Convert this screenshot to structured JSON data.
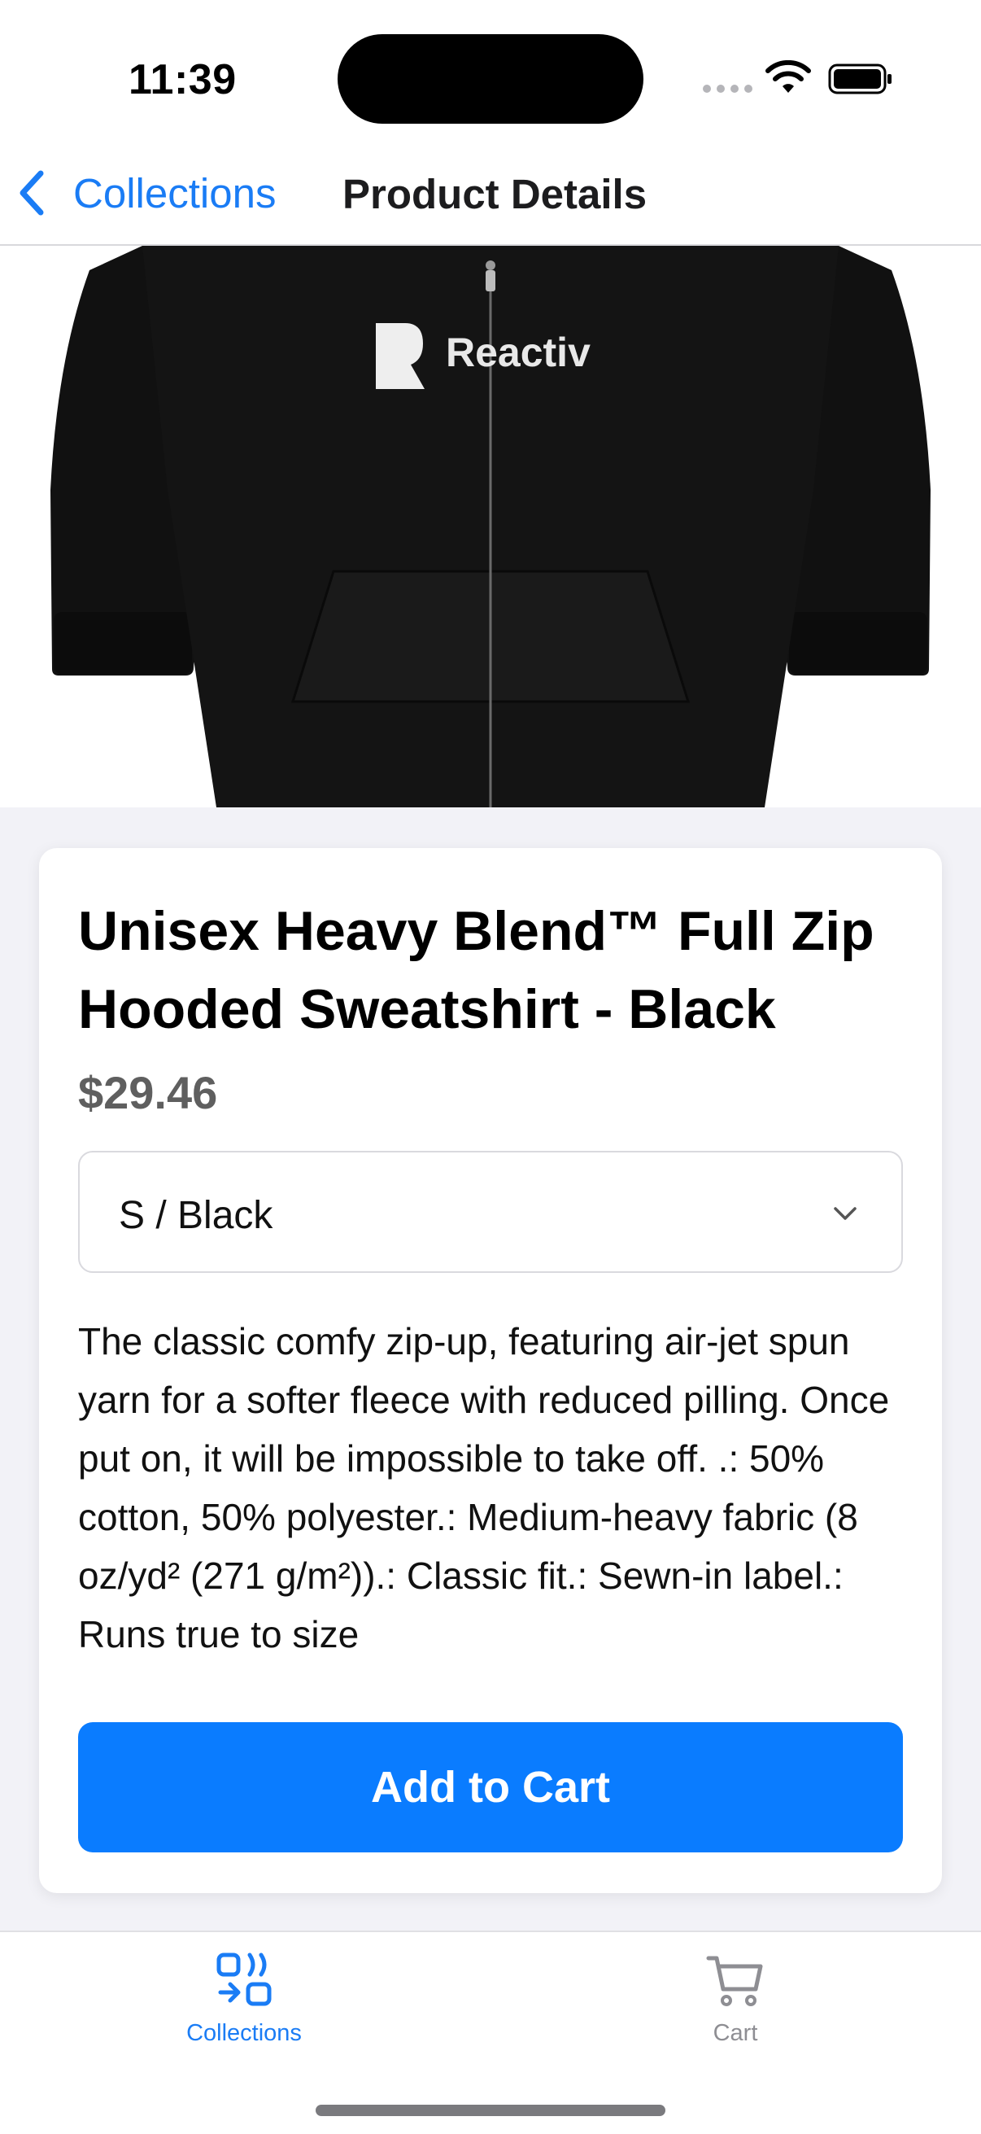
{
  "status_bar": {
    "time": "11:39"
  },
  "nav": {
    "back_label": "Collections",
    "title": "Product Details"
  },
  "product": {
    "image_brand_text": "Reactiv",
    "title": "Unisex Heavy Blend™ Full Zip Hooded Sweatshirt - Black",
    "price": "$29.46",
    "variant_selected": "S / Black",
    "description": "The classic comfy zip-up, featuring air-jet spun yarn for a softer fleece with reduced pilling. Once put on, it will be impossible to take off. .: 50% cotton, 50% polyester.: Medium-heavy fabric (8 oz/yd² (271 g/m²)).: Classic fit.: Sewn-in label.: Runs true to size",
    "add_to_cart_label": "Add to Cart"
  },
  "tab_bar": {
    "tabs": [
      {
        "label": "Collections",
        "icon": "collections-icon",
        "active": true
      },
      {
        "label": "Cart",
        "icon": "cart-icon",
        "active": false
      }
    ]
  },
  "colors": {
    "accent": "#1a7cf5",
    "button": "#0a7cff",
    "price": "#5f5f5f",
    "inactive_tab": "#8e8e93"
  }
}
